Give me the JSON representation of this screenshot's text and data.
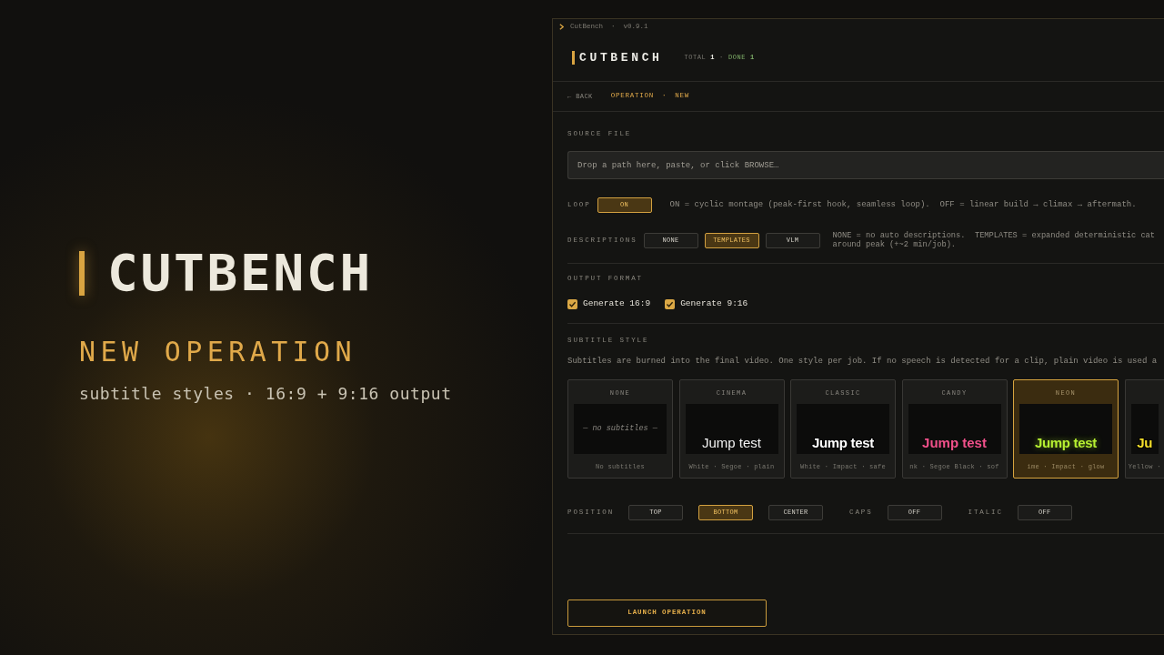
{
  "hero": {
    "title": "CUTBENCH",
    "subtitle": "NEW OPERATION",
    "tagline": "subtitle styles · 16:9 + 9:16 output"
  },
  "window": {
    "title": "CutBench  ·  v0.9.1"
  },
  "header": {
    "brand": "CUTBENCH",
    "stats": [
      {
        "label": "TOTAL",
        "value": "1",
        "kind": "total"
      },
      {
        "label": "DONE",
        "value": "1",
        "kind": "done"
      }
    ],
    "stat_separator": "·"
  },
  "breadcrumb": {
    "back": "← BACK",
    "items": [
      "OPERATION",
      "NEW"
    ],
    "separator": "·"
  },
  "source_file": {
    "label": "SOURCE FILE",
    "placeholder": "Drop a path here, paste, or click BROWSE…"
  },
  "loop": {
    "label": "LOOP",
    "toggle": {
      "text": "ON",
      "on": true
    },
    "note": "ON = cyclic montage (peak-first hook, seamless loop).  OFF = linear build → climax → aftermath."
  },
  "descriptions": {
    "label": "DESCRIPTIONS",
    "options": [
      {
        "label": "NONE",
        "selected": false
      },
      {
        "label": "TEMPLATES",
        "selected": true
      },
      {
        "label": "VLM",
        "selected": false
      }
    ],
    "note_lines": [
      "NONE = no auto descriptions.  TEMPLATES = expanded deterministic cat",
      "around peak (+~2 min/job)."
    ]
  },
  "output_format": {
    "label": "OUTPUT FORMAT",
    "options": [
      {
        "label": "Generate 16:9",
        "checked": true
      },
      {
        "label": "Generate 9:16",
        "checked": true
      }
    ]
  },
  "subtitle_style": {
    "label": "SUBTITLE STYLE",
    "note": "Subtitles are burned into the final video. One style per job. If no speech is detected for a clip, plain video is used a",
    "cards": [
      {
        "title": "NONE",
        "preview": "— no subtitles —",
        "caption": "No subtitles",
        "kind": "none",
        "selected": false
      },
      {
        "title": "CINEMA",
        "preview": "Jump test",
        "caption": "White · Segoe · plain",
        "kind": "plain",
        "color": "#f2f2f2",
        "selected": false
      },
      {
        "title": "CLASSIC",
        "preview": "Jump test",
        "caption": "White · Impact · safe",
        "kind": "outline",
        "color": "#ffffff",
        "selected": false
      },
      {
        "title": "CANDY",
        "preview": "Jump test",
        "caption": "nk · Segoe Black · sof",
        "kind": "bold",
        "color": "#f0508a",
        "selected": false
      },
      {
        "title": "NEON",
        "preview": "Jump test",
        "caption": "ime · Impact · glow",
        "kind": "glow",
        "color": "#b6f032",
        "selected": true
      },
      {
        "preview": "Ju",
        "caption": "Yellow ·",
        "kind": "outline",
        "color": "#f5df2a",
        "selected": false
      }
    ]
  },
  "subtitle_options": [
    {
      "label": "POSITION",
      "kind": "choice",
      "options": [
        {
          "label": "TOP",
          "selected": false
        },
        {
          "label": "BOTTOM",
          "selected": true
        },
        {
          "label": "CENTER",
          "selected": false
        }
      ]
    },
    {
      "label": "CAPS",
      "kind": "toggle",
      "toggle": {
        "text": "OFF",
        "on": false
      }
    },
    {
      "label": "ITALIC",
      "kind": "toggle",
      "toggle": {
        "text": "OFF",
        "on": false
      }
    }
  ],
  "launch_button": "LAUNCH OPERATION"
}
